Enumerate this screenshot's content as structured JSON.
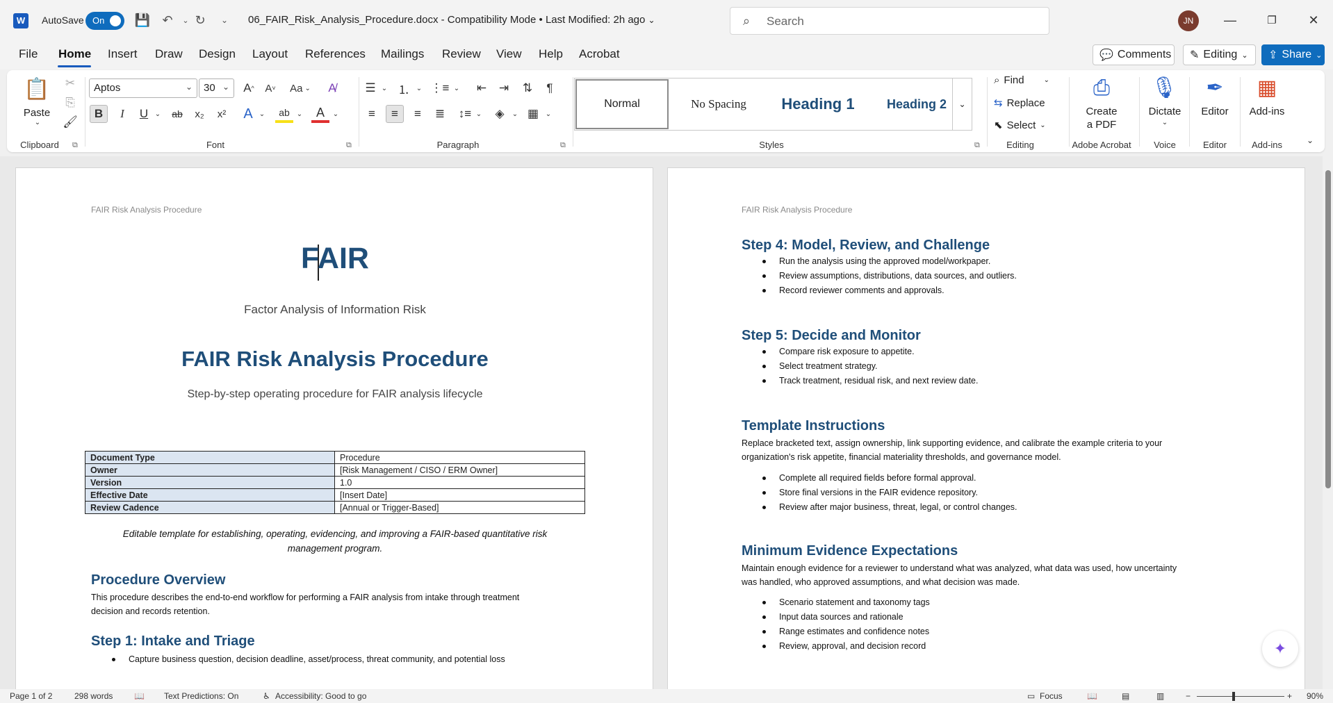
{
  "titlebar": {
    "app_logo": "W",
    "autosave_label": "AutoSave",
    "autosave_state": "On",
    "doc_title": "06_FAIR_Risk_Analysis_Procedure.docx  -  Compatibility Mode  •  Last Modified: 2h ago",
    "search_placeholder": "Search",
    "user_initials": "JN"
  },
  "menu": {
    "tabs": [
      "File",
      "Home",
      "Insert",
      "Draw",
      "Design",
      "Layout",
      "References",
      "Mailings",
      "Review",
      "View",
      "Help",
      "Acrobat"
    ],
    "active_tab": "Home",
    "comments": "Comments",
    "editing": "Editing",
    "share": "Share"
  },
  "ribbon": {
    "clipboard": {
      "paste": "Paste",
      "label": "Clipboard"
    },
    "font": {
      "name": "Aptos",
      "size": "30",
      "case": "Aa",
      "label": "Font",
      "bold": "B",
      "italic": "I",
      "underline": "U",
      "strike": "ab",
      "sub": "x₂",
      "sup": "x²",
      "effects": "A",
      "highlight": "ab",
      "color": "A"
    },
    "paragraph": {
      "label": "Paragraph"
    },
    "styles": {
      "items": [
        "Normal",
        "No Spacing",
        "Heading 1",
        "Heading 2"
      ],
      "label": "Styles"
    },
    "editing": {
      "find": "Find",
      "replace": "Replace",
      "select": "Select",
      "label": "Editing"
    },
    "acrobat": {
      "line1": "Create",
      "line2": "a PDF",
      "label": "Adobe Acrobat"
    },
    "voice": {
      "button": "Dictate",
      "label": "Voice"
    },
    "editor": {
      "button": "Editor",
      "label": "Editor"
    },
    "addins": {
      "button": "Add-ins",
      "label": "Add-ins"
    }
  },
  "page1": {
    "header": "FAIR Risk Analysis Procedure",
    "title": "FAIR",
    "subtitle": "Factor Analysis of Information Risk",
    "doc_heading": "FAIR Risk Analysis Procedure",
    "doc_subheading": "Step-by-step operating procedure for FAIR analysis lifecycle",
    "meta": [
      {
        "k": "Document Type",
        "v": "Procedure"
      },
      {
        "k": "Owner",
        "v": "[Risk Management / CISO / ERM Owner]"
      },
      {
        "k": "Version",
        "v": "1.0"
      },
      {
        "k": "Effective Date",
        "v": "[Insert Date]"
      },
      {
        "k": "Review Cadence",
        "v": "[Annual or Trigger-Based]"
      }
    ],
    "note_line1": "Editable template for establishing, operating, evidencing, and improving a FAIR-based quantitative risk",
    "note_line2": "management program.",
    "overview_heading": "Procedure Overview",
    "overview_line1": "This procedure describes the end-to-end workflow for performing a FAIR analysis from intake through treatment",
    "overview_line2": "decision and records retention.",
    "step1_heading": "Step 1: Intake and Triage",
    "step1_bullets": [
      "Capture business question, decision deadline, asset/process, threat community, and potential loss"
    ]
  },
  "page2": {
    "header": "FAIR Risk Analysis Procedure",
    "step4_heading": "Step 4: Model, Review, and Challenge",
    "step4_bullets": [
      "Run the analysis using the approved model/workpaper.",
      "Review assumptions, distributions, data sources, and outliers.",
      "Record reviewer comments and approvals."
    ],
    "step5_heading": "Step 5: Decide and Monitor",
    "step5_bullets": [
      "Compare risk exposure to appetite.",
      "Select treatment strategy.",
      "Track treatment, residual risk, and next review date."
    ],
    "template_heading": "Template Instructions",
    "template_line1": "Replace bracketed text, assign ownership, link supporting evidence, and calibrate the example criteria to your",
    "template_line2": "organization's risk appetite, financial materiality thresholds, and governance model.",
    "template_bullets": [
      "Complete all required fields before formal approval.",
      "Store final versions in the FAIR evidence repository.",
      "Review after major business, threat, legal, or control changes."
    ],
    "evidence_heading": "Minimum Evidence Expectations",
    "evidence_line1": "Maintain enough evidence for a reviewer to understand what was analyzed, what data was used, how uncertainty",
    "evidence_line2": "was handled, who approved assumptions, and what decision was made.",
    "evidence_bullets": [
      "Scenario statement and taxonomy tags",
      "Input data sources and rationale",
      "Range estimates and confidence notes",
      "Review, approval, and decision record"
    ]
  },
  "status": {
    "page": "Page 1 of 2",
    "words": "298 words",
    "predictions": "Text Predictions: On",
    "accessibility": "Accessibility: Good to go",
    "focus": "Focus",
    "zoom": "90%"
  }
}
